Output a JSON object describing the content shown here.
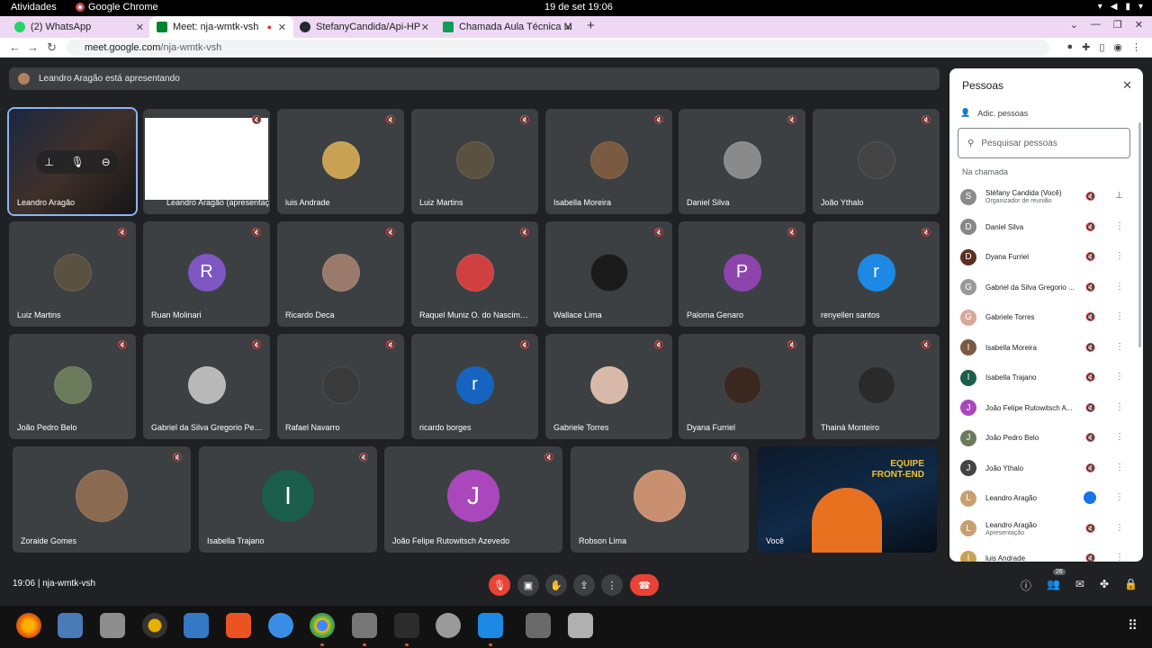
{
  "system": {
    "activities": "Atividades",
    "app": "Google Chrome",
    "clock": "19 de set  19:06"
  },
  "tabs": [
    {
      "label": "(2) WhatsApp",
      "color": "#25d366"
    },
    {
      "label": "Meet: nja-wmtk-vsh",
      "color": "#00832d"
    },
    {
      "label": "StefanyCandida/Api-HP",
      "color": "#24292f"
    },
    {
      "label": "Chamada Aula Técnica M",
      "color": "#0f9d58"
    }
  ],
  "url": {
    "host": "meet.google.com",
    "path": "/nja-wmtk-vsh"
  },
  "presenting": "Leandro Aragão está apresentando",
  "grid": [
    {
      "name": "Leandro Aragão",
      "kind": "video"
    },
    {
      "name": "Leandro Aragão (apresentação)",
      "kind": "screen"
    },
    {
      "name": "luis Andrade",
      "kind": "photo",
      "color": "#c8a252"
    },
    {
      "name": "Luiz Martins",
      "kind": "photo",
      "color": "#5b5140"
    },
    {
      "name": "Isabella Moreira",
      "kind": "photo",
      "color": "#7a5a40"
    },
    {
      "name": "Daniel Silva",
      "kind": "photo",
      "color": "#8a8a8a"
    },
    {
      "name": "João Ythalo",
      "kind": "photo",
      "color": "#444444"
    },
    {
      "name": "Luiz Martins",
      "kind": "photo",
      "color": "#5b5140"
    },
    {
      "name": "Ruan Molinari",
      "kind": "initial",
      "initial": "R",
      "color": "#7e57c2"
    },
    {
      "name": "Ricardo Deca",
      "kind": "photo",
      "color": "#9a7a6a"
    },
    {
      "name": "Raquel Muniz O. do Nascimento",
      "kind": "photo",
      "color": "#d04040"
    },
    {
      "name": "Wallace Lima",
      "kind": "photo",
      "color": "#1a1a1a"
    },
    {
      "name": "Paloma Genaro",
      "kind": "initial",
      "initial": "P",
      "color": "#8e44ad"
    },
    {
      "name": "renyellen santos",
      "kind": "initial",
      "initial": "r",
      "color": "#1e88e5"
    },
    {
      "name": "João Pedro Belo",
      "kind": "photo",
      "color": "#6a7a5a"
    },
    {
      "name": "Gabriel da Silva Gregorio Pereira",
      "kind": "photo",
      "color": "#b8b8b8"
    },
    {
      "name": "Rafael Navarro",
      "kind": "photo",
      "color": "#3a3a3a"
    },
    {
      "name": "ricardo borges",
      "kind": "initial",
      "initial": "r",
      "color": "#1565c0"
    },
    {
      "name": "Gabriele Torres",
      "kind": "photo",
      "color": "#d8b8a8"
    },
    {
      "name": "Dyana Furriel",
      "kind": "photo",
      "color": "#3a2820"
    },
    {
      "name": "Thainá Monteiro",
      "kind": "photo",
      "color": "#2a2a2a"
    },
    {
      "name": "Zoraide Gomes",
      "kind": "photo",
      "color": "#8a6a50"
    },
    {
      "name": "Isabella Trajano",
      "kind": "initial",
      "initial": "I",
      "color": "#1b5e4b"
    },
    {
      "name": "João Felipe Rutowitsch Azevedo",
      "kind": "initial",
      "initial": "J",
      "color": "#ab47bc"
    },
    {
      "name": "Robson Lima",
      "kind": "photo",
      "color": "#c89070"
    },
    {
      "name": "Você",
      "kind": "self"
    }
  ],
  "self_overlay": {
    "text1": "EQUIPE",
    "text2": "FRONT-END"
  },
  "people_panel": {
    "title": "Pessoas",
    "add": "Adic. pessoas",
    "search_placeholder": "Pesquisar pessoas",
    "section": "Na chamada",
    "people": [
      {
        "name": "Stéfany Candida (Você)",
        "sub": "Organizador de reunião",
        "initial": "S",
        "color": "#8a8a8a"
      },
      {
        "name": "Daniel Silva",
        "initial": "D",
        "color": "#888888"
      },
      {
        "name": "Dyana Furriel",
        "initial": "D",
        "color": "#5a3020"
      },
      {
        "name": "Gabriel da Silva Gregorio ...",
        "initial": "G",
        "color": "#999999"
      },
      {
        "name": "Gabriele Torres",
        "initial": "G",
        "color": "#d8a898"
      },
      {
        "name": "Isabella Moreira",
        "initial": "I",
        "color": "#7a5a40"
      },
      {
        "name": "Isabella Trajano",
        "initial": "I",
        "color": "#1b5e4b"
      },
      {
        "name": "João Felipe Rutowitsch A...",
        "initial": "J",
        "color": "#ab47bc"
      },
      {
        "name": "João Pedro Belo",
        "initial": "J",
        "color": "#6a7a5a"
      },
      {
        "name": "João Ythalo",
        "initial": "J",
        "color": "#444444"
      },
      {
        "name": "Leandro Aragão",
        "initial": "L",
        "color": "#c8a070"
      },
      {
        "name": "Leandro Aragão",
        "sub": "Apresentação",
        "initial": "L",
        "color": "#c8a070"
      },
      {
        "name": "luis Andrade",
        "initial": "l",
        "color": "#c8a252"
      }
    ]
  },
  "bottom": {
    "time": "19:06",
    "meeting": "nja-wmtk-vsh",
    "people_count": "26"
  }
}
